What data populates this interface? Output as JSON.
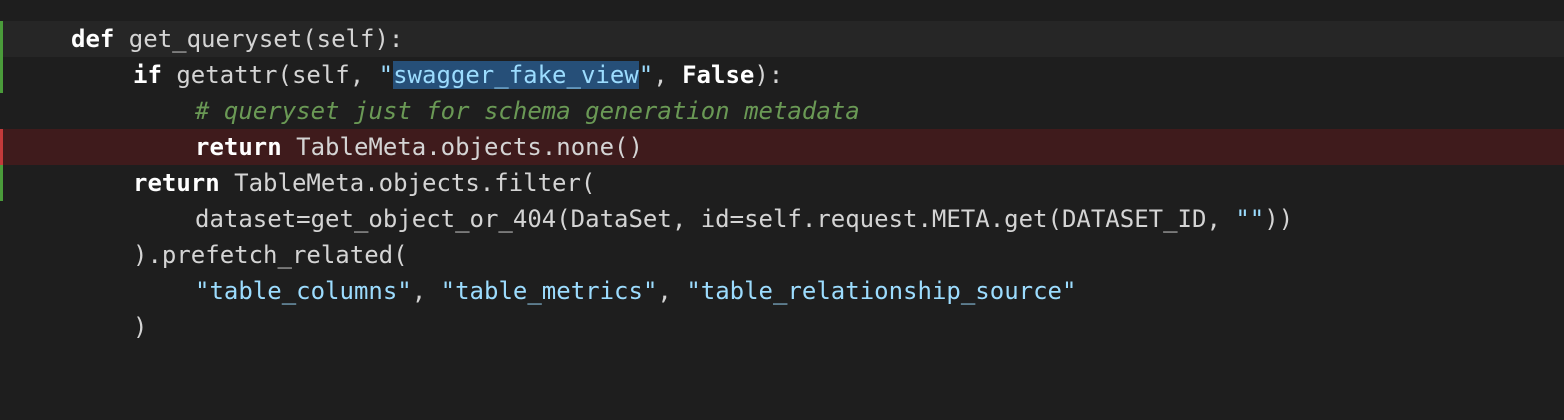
{
  "code": {
    "lines": [
      {
        "indent": 1,
        "state": "current",
        "gutter": "added",
        "tokens": [
          {
            "type": "kw",
            "text": "def"
          },
          {
            "type": "plain",
            "text": " get_queryset(self):"
          }
        ]
      },
      {
        "indent": 2,
        "state": "normal",
        "gutter": "added",
        "tokens": [
          {
            "type": "kw",
            "text": "if"
          },
          {
            "type": "plain",
            "text": " getattr(self, "
          },
          {
            "type": "str",
            "text": "\""
          },
          {
            "type": "sel",
            "text": "swagger_fake_view"
          },
          {
            "type": "str",
            "text": "\""
          },
          {
            "type": "plain",
            "text": ", "
          },
          {
            "type": "kw",
            "text": "False"
          },
          {
            "type": "plain",
            "text": "):"
          }
        ]
      },
      {
        "indent": 3,
        "state": "normal",
        "gutter": "none",
        "tokens": [
          {
            "type": "cmt",
            "text": "# queryset just for schema generation metadata"
          }
        ]
      },
      {
        "indent": 3,
        "state": "deleted",
        "gutter": "removed",
        "tokens": [
          {
            "type": "kw",
            "text": "return"
          },
          {
            "type": "plain",
            "text": " TableMeta.objects.none()"
          }
        ]
      },
      {
        "indent": 2,
        "state": "normal",
        "gutter": "added",
        "tokens": [
          {
            "type": "kw",
            "text": "return"
          },
          {
            "type": "plain",
            "text": " TableMeta.objects.filter("
          }
        ]
      },
      {
        "indent": 3,
        "state": "normal",
        "gutter": "none",
        "tokens": [
          {
            "type": "plain",
            "text": "dataset=get_object_or_404(DataSet, id=self.request.META.get(DATASET_ID, "
          },
          {
            "type": "str",
            "text": "\"\""
          },
          {
            "type": "plain",
            "text": "))"
          }
        ]
      },
      {
        "indent": 2,
        "state": "normal",
        "gutter": "none",
        "tokens": [
          {
            "type": "plain",
            "text": ").prefetch_related("
          }
        ]
      },
      {
        "indent": 3,
        "state": "normal",
        "gutter": "none",
        "tokens": [
          {
            "type": "str",
            "text": "\"table_columns\""
          },
          {
            "type": "plain",
            "text": ", "
          },
          {
            "type": "str",
            "text": "\"table_metrics\""
          },
          {
            "type": "plain",
            "text": ", "
          },
          {
            "type": "str",
            "text": "\"table_relationship_source\""
          }
        ]
      },
      {
        "indent": 2,
        "state": "normal",
        "gutter": "none",
        "tokens": [
          {
            "type": "plain",
            "text": ")"
          }
        ]
      }
    ]
  },
  "colors": {
    "background": "#1e1e1e",
    "keyword": "#ffffff",
    "string": "#9cdcfe",
    "comment": "#6a9955",
    "selection": "#264f78",
    "deleted_line": "#3f1b1c",
    "gutter_added": "#4a9b3a",
    "gutter_removed": "#c23a3a"
  }
}
